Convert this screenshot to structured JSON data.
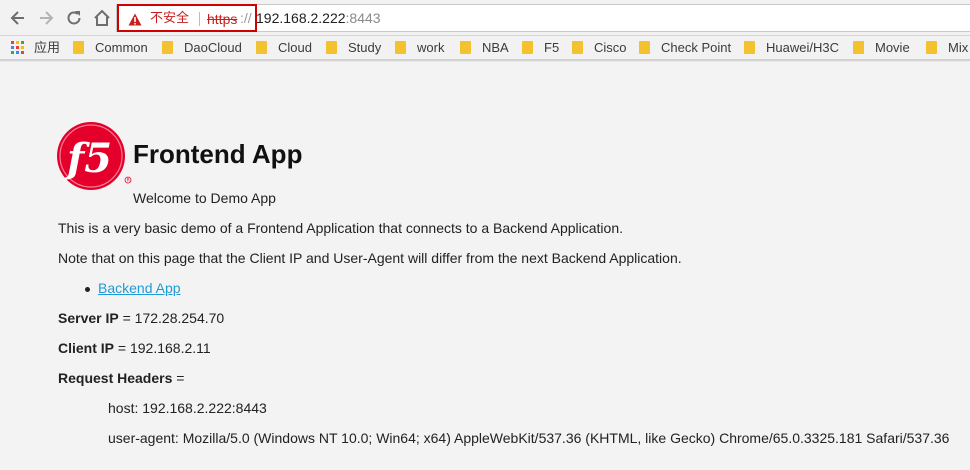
{
  "browser": {
    "security": {
      "label": "不安全",
      "scheme": "https",
      "slashes": "://"
    },
    "url": {
      "host": "192.168.2.222",
      "port": ":8443"
    },
    "bookmarks": [
      {
        "label": "应用",
        "icon": "apps-grid-icon"
      },
      {
        "label": "Common",
        "icon": "folder-icon"
      },
      {
        "label": "DaoCloud",
        "icon": "folder-icon"
      },
      {
        "label": "Cloud",
        "icon": "folder-icon"
      },
      {
        "label": "Study",
        "icon": "folder-icon"
      },
      {
        "label": "work",
        "icon": "folder-icon"
      },
      {
        "label": "NBA",
        "icon": "folder-icon"
      },
      {
        "label": "F5",
        "icon": "folder-icon"
      },
      {
        "label": "Cisco",
        "icon": "folder-icon"
      },
      {
        "label": "Check Point",
        "icon": "folder-icon"
      },
      {
        "label": "Huawei/H3C",
        "icon": "folder-icon"
      },
      {
        "label": "Movie",
        "icon": "folder-icon"
      },
      {
        "label": "Mix",
        "icon": "folder-icon"
      }
    ]
  },
  "page": {
    "title": "Frontend App",
    "welcome": "Welcome to Demo App",
    "intro": "This is a very basic demo of a Frontend Application that connects to a Backend Application.",
    "note": "Note that on this page that the Client IP and User-Agent will differ from the next Backend Application.",
    "link_label": "Backend App",
    "server_ip": {
      "label": "Server IP",
      "value": " = 172.28.254.70"
    },
    "client_ip": {
      "label": "Client IP",
      "value": " = 192.168.2.11"
    },
    "request_headers": {
      "label": "Request Headers",
      "suffix": " ="
    },
    "headers": [
      "host: 192.168.2.222:8443",
      "user-agent: Mozilla/5.0 (Windows NT 10.0; Win64; x64) AppleWebKit/537.36 (KHTML, like Gecko) Chrome/65.0.3325.181 Safari/537.36"
    ]
  },
  "colors": {
    "warning": "#c5221f",
    "link": "#1e9bd7",
    "f5_red": "#e4002b",
    "folder": "#f2c230"
  }
}
